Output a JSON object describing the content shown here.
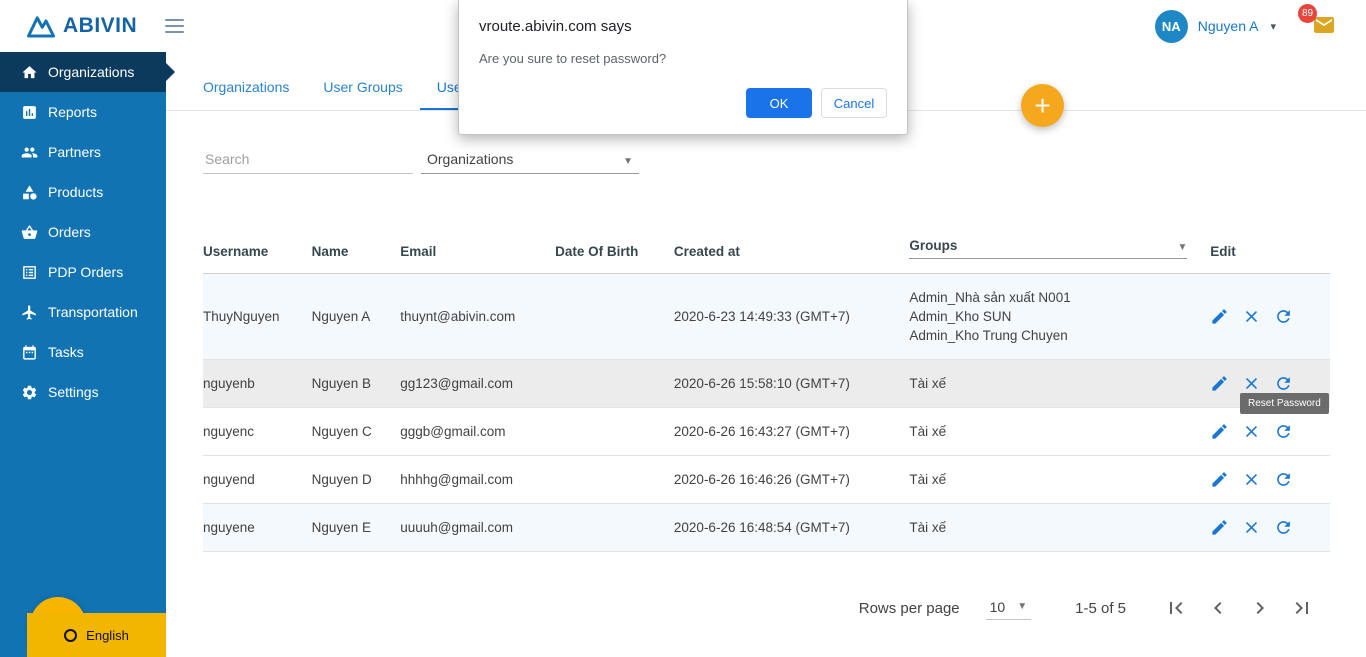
{
  "header": {
    "brand": "ABIVIN",
    "user_initials": "NA",
    "user_name": "Nguyen A",
    "notification_count": "89"
  },
  "dialog": {
    "title": "vroute.abivin.com says",
    "message": "Are you sure to reset password?",
    "ok_label": "OK",
    "cancel_label": "Cancel"
  },
  "sidebar": {
    "items": [
      {
        "label": "Organizations",
        "icon": "home-icon",
        "active": true
      },
      {
        "label": "Reports",
        "icon": "chart-icon",
        "active": false
      },
      {
        "label": "Partners",
        "icon": "people-icon",
        "active": false
      },
      {
        "label": "Products",
        "icon": "products-icon",
        "active": false
      },
      {
        "label": "Orders",
        "icon": "orders-icon",
        "active": false
      },
      {
        "label": "PDP Orders",
        "icon": "list-icon",
        "active": false
      },
      {
        "label": "Transportation",
        "icon": "plane-icon",
        "active": false
      },
      {
        "label": "Tasks",
        "icon": "calendar-icon",
        "active": false
      },
      {
        "label": "Settings",
        "icon": "gear-icon",
        "active": false
      }
    ],
    "language": "English"
  },
  "tabs": [
    {
      "label": "Organizations",
      "active": false
    },
    {
      "label": "User Groups",
      "active": false
    },
    {
      "label": "Users",
      "active": true
    }
  ],
  "filters": {
    "search_placeholder": "Search",
    "organization_filter": "Organizations"
  },
  "fab_label": "+",
  "table": {
    "columns": [
      "Username",
      "Name",
      "Email",
      "Date Of Birth",
      "Created at",
      "Groups",
      "Edit"
    ],
    "rows": [
      {
        "username": "ThuyNguyen",
        "name": "Nguyen A",
        "email": "thuynt@abivin.com",
        "dob": "",
        "created_at": "2020-6-23 14:49:33 (GMT+7)",
        "groups": [
          "Admin_Nhà sản xuất N001",
          "Admin_Kho SUN",
          "Admin_Kho Trung Chuyen"
        ]
      },
      {
        "username": "nguyenb",
        "name": "Nguyen B",
        "email": "gg123@gmail.com",
        "dob": "",
        "created_at": "2020-6-26 15:58:10 (GMT+7)",
        "groups": [
          "Tài xế"
        ]
      },
      {
        "username": "nguyenc",
        "name": "Nguyen C",
        "email": "gggb@gmail.com",
        "dob": "",
        "created_at": "2020-6-26 16:43:27 (GMT+7)",
        "groups": [
          "Tài xế"
        ]
      },
      {
        "username": "nguyend",
        "name": "Nguyen D",
        "email": "hhhhg@gmail.com",
        "dob": "",
        "created_at": "2020-6-26 16:46:26 (GMT+7)",
        "groups": [
          "Tài xế"
        ]
      },
      {
        "username": "nguyene",
        "name": "Nguyen E",
        "email": "uuuuh@gmail.com",
        "dob": "",
        "created_at": "2020-6-26 16:48:54 (GMT+7)",
        "groups": [
          "Tài xế"
        ]
      }
    ]
  },
  "tooltip": {
    "text": "Reset Password"
  },
  "pagination": {
    "rows_per_page_label": "Rows per page",
    "rows_per_page_value": "10",
    "range": "1-5 of 5"
  },
  "colors": {
    "sidebar_blue": "#1173b2",
    "sidebar_active": "#0b3a5d",
    "accent_blue": "#1976d2",
    "fab_orange": "#f5a81e",
    "yellow": "#f7b500",
    "badge_red": "#e8453c",
    "dialog_ok_blue": "#1a73e8"
  }
}
